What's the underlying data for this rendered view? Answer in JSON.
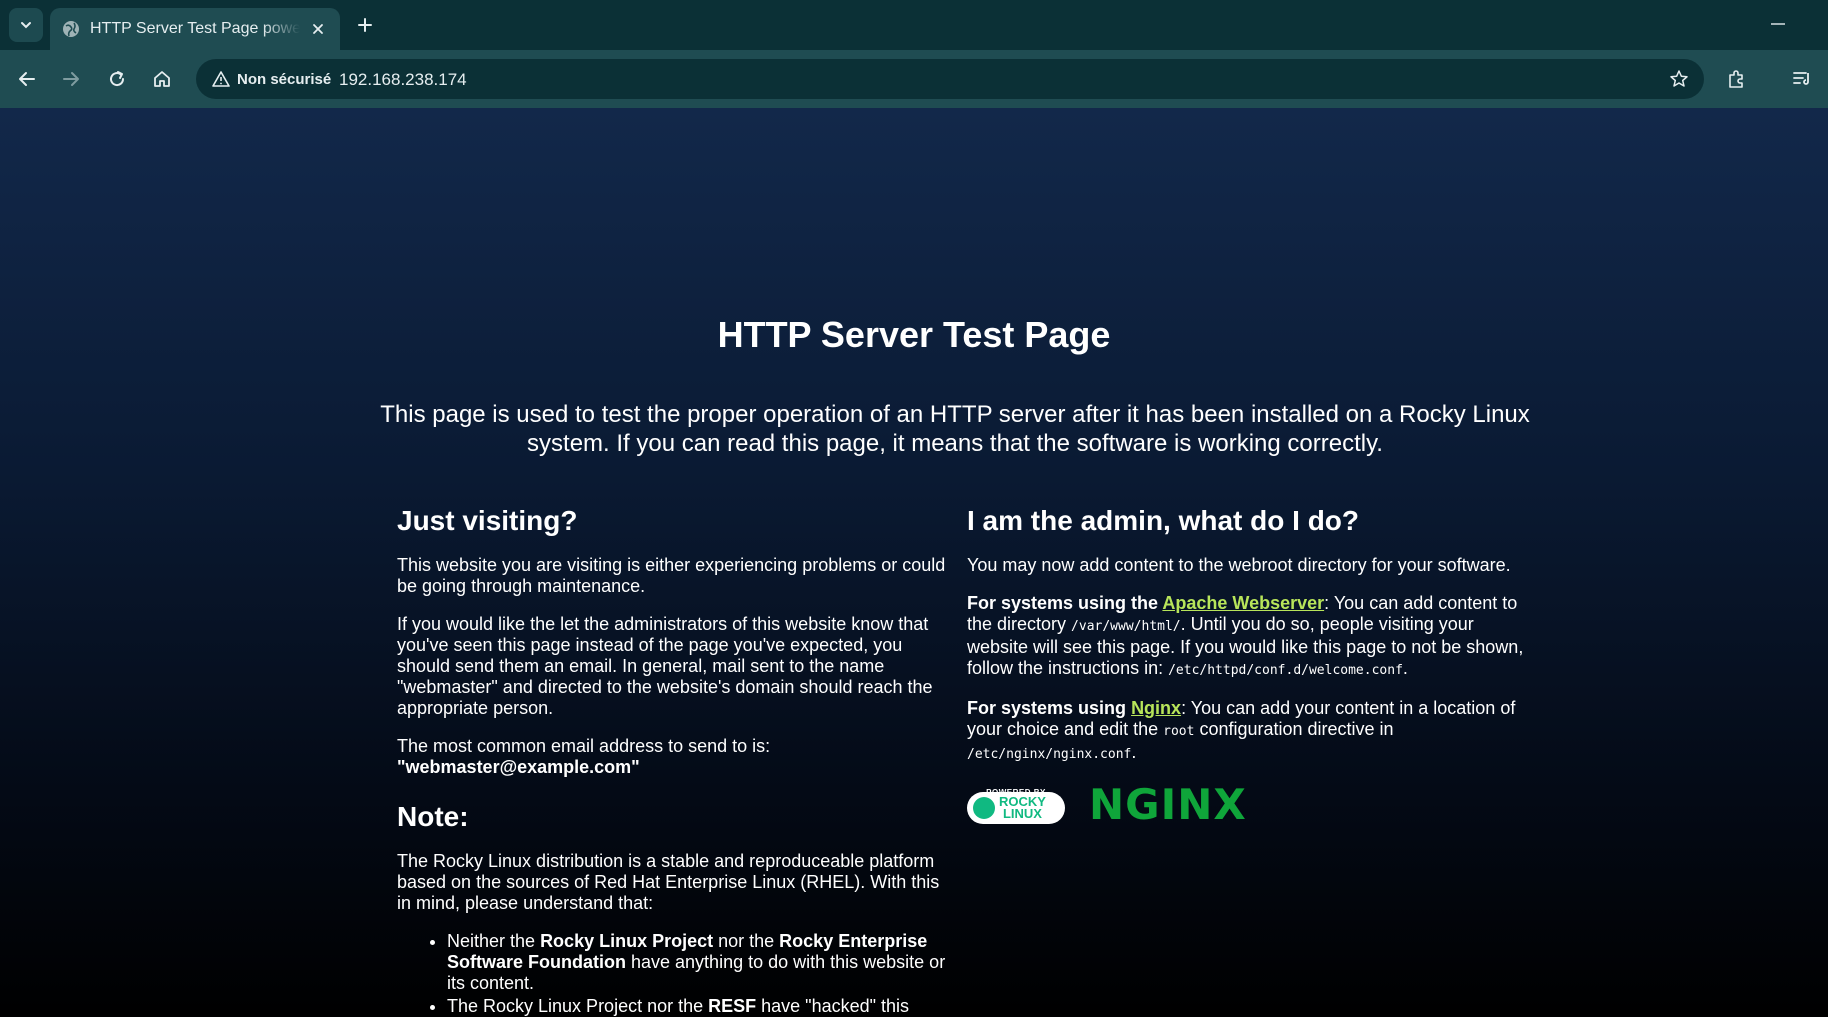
{
  "browser": {
    "tab": {
      "title": "HTTP Server Test Page powered by Rocky Linux"
    },
    "address_bar": {
      "security_label": "Non sécurisé",
      "url": "192.168.238.174"
    },
    "icons": [
      "chevron-down-icon",
      "globe-icon",
      "close-icon",
      "plus-icon",
      "minimize-icon",
      "back-icon",
      "forward-icon",
      "reload-icon",
      "home-icon",
      "warning-icon",
      "star-icon",
      "extensions-icon",
      "reading-list-icon"
    ]
  },
  "page": {
    "title": "HTTP Server Test Page",
    "lead": "This page is used to test the proper operation of an HTTP server after it has been installed on a Rocky Linux system. If you can read this page, it means that the software is working correctly.",
    "left": {
      "heading": "Just visiting?",
      "p1": "This website you are visiting is either experiencing problems or could be going through maintenance.",
      "p2": "If you would like the let the administrators of this website know that you've seen this page instead of the page you've expected, you should send them an email. In general, mail sent to the name \"webmaster\" and directed to the website's domain should reach the appropriate person.",
      "p3": "The most common email address to send to is:",
      "email": "\"webmaster@example.com\"",
      "note_heading": "Note:",
      "note_p": "The Rocky Linux distribution is a stable and reproduceable platform based on the sources of Red Hat Enterprise Linux (RHEL). With this in mind, please understand that:",
      "bullet1": {
        "t1": "Neither the ",
        "b1": "Rocky Linux Project",
        "t2": " nor the ",
        "b2": "Rocky Enterprise Software Foundation",
        "t3": " have anything to do with this website or its content."
      },
      "bullet2": {
        "t1": "The Rocky Linux Project nor the ",
        "b1": "RESF",
        "t2": " have \"hacked\" this"
      }
    },
    "right": {
      "heading": "I am the admin, what do I do?",
      "p1": "You may now add content to the webroot directory for your software.",
      "apache": {
        "lead": "For systems using the ",
        "link": "Apache Webserver",
        "t1": ": You can add content to the directory ",
        "code1": "/var/www/html/",
        "t2": ". Until you do so, people visiting your website will see this page. If you would like this page to not be shown, follow the instructions in: ",
        "code2": "/etc/httpd/conf.d/welcome.conf",
        "t3": "."
      },
      "nginx": {
        "lead": "For systems using ",
        "link": "Nginx",
        "t1": ": You can add your content in a location of your choice and edit the ",
        "code1": "root",
        "t2": " configuration directive in ",
        "code2": "/etc/nginx/nginx.conf",
        "t3": "."
      },
      "logos": {
        "rocky_powered": "POWERED BY",
        "rocky_text1": "ROCKY",
        "rocky_text2": "LINUX",
        "nginx_text": "NGINX"
      }
    }
  }
}
